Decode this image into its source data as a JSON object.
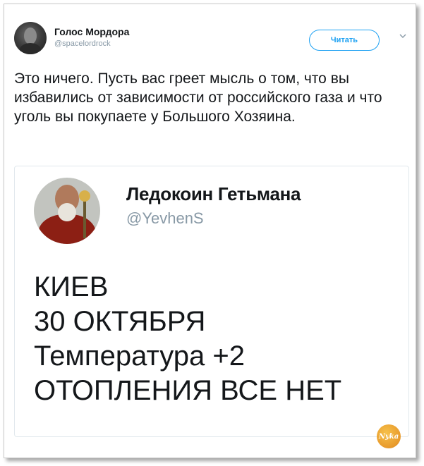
{
  "author": {
    "display_name": "Голос Мордора",
    "handle": "@spacelordrock",
    "avatar_icon": "user-avatar"
  },
  "follow_button": {
    "label": "Читать",
    "color": "#1da1f2"
  },
  "menu_icon": "chevron-down-icon",
  "tweet": {
    "text": "Это ничего. Пусть вас греет мысль о том, что вы избавились от зависимости от российского газа и что уголь вы покупаете у Большого Хозяина."
  },
  "quoted_tweet": {
    "display_name": "Ледокоин Гетьмана",
    "handle": "@YevhenS",
    "lines": [
      "КИЕВ",
      "30 ОКТЯБРЯ",
      "Температура +2",
      "ОТОПЛЕНИЯ ВСЕ НЕТ"
    ]
  },
  "watermark": {
    "text": "Nyka"
  }
}
